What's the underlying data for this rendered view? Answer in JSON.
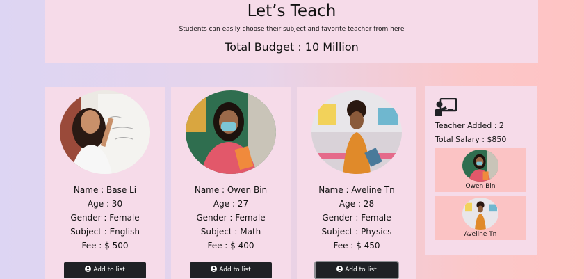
{
  "header": {
    "title": "Let’s Teach",
    "subtitle": "Students can easily choose their subject and favorite teacher from here",
    "budget": "Total Budget : 10 Million"
  },
  "teachers": [
    {
      "name": "Name : Base Li",
      "age": "Age : 30",
      "gender": "Gender : Female",
      "subject": "Subject : English",
      "fee": "Fee : $ 500",
      "button": "Add to list"
    },
    {
      "name": "Name : Owen Bin",
      "age": "Age : 27",
      "gender": "Gender : Female",
      "subject": "Subject : Math",
      "fee": "Fee : $ 400",
      "button": "Add to list"
    },
    {
      "name": "Name : Aveline Tn",
      "age": "Age : 28",
      "gender": "Gender : Female",
      "subject": "Subject : Physics",
      "fee": "Fee : $ 450",
      "button": "Add to list"
    }
  ],
  "summary": {
    "icon": "teacher-board-icon",
    "teacher_added": "Teacher Added : 2",
    "total_salary": "Total Salary : $850",
    "added": [
      {
        "name": "Owen Bin"
      },
      {
        "name": "Aveline Tn"
      }
    ]
  },
  "icons": {
    "button": "user-circle-icon"
  }
}
